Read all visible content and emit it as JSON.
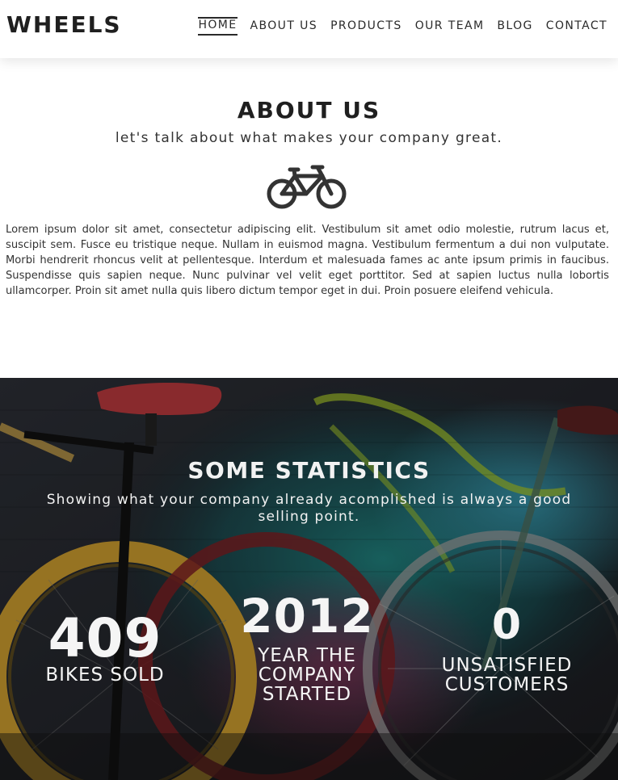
{
  "header": {
    "logo": "WHEELS",
    "nav": [
      {
        "label": "HOME",
        "active": true
      },
      {
        "label": "ABOUT US"
      },
      {
        "label": "PRODUCTS"
      },
      {
        "label": "OUR TEAM"
      },
      {
        "label": "BLOG"
      },
      {
        "label": "CONTACT"
      }
    ]
  },
  "about": {
    "title": "ABOUT US",
    "subtitle": "let's talk about what makes your company great.",
    "icon": "bicycle-icon",
    "text": "Lorem ipsum dolor sit amet, consectetur adipiscing elit. Vestibulum sit amet odio molestie, rutrum lacus et, suscipit sem. Fusce eu tristique neque. Nullam in euismod magna. Vestibulum fermentum a dui non vulputate. Morbi hendrerit rhoncus velit at pellentesque. Interdum et malesuada fames ac ante ipsum primis in faucibus. Suspendisse quis sapien neque. Nunc pulvinar vel velit eget porttitor. Sed at sapien luctus nulla lobortis ullamcorper. Proin sit amet nulla quis libero dictum tempor eget in dui. Proin posuere eleifend vehicula."
  },
  "stats": {
    "title": "SOME STATISTICS",
    "subtitle": "Showing what your company already acomplished is always a good selling point.",
    "items": [
      {
        "value": "409",
        "label": "BIKES SOLD"
      },
      {
        "value": "2012",
        "label": "YEAR THE COMPANY STARTED"
      },
      {
        "value": "0",
        "label": "UNSATISFIED CUSTOMERS"
      }
    ]
  }
}
